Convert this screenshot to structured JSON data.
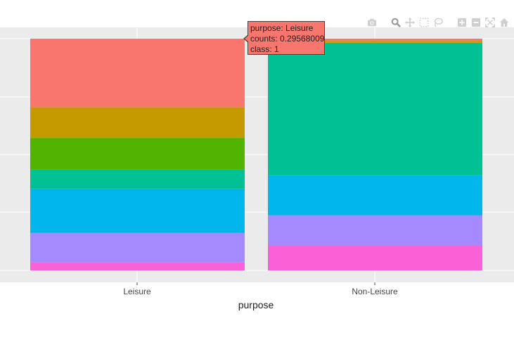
{
  "chart_data": {
    "type": "bar",
    "stacked": true,
    "normalized": true,
    "xlabel": "purpose",
    "categories": [
      "Leisure",
      "Non-Leisure"
    ],
    "ylim": [
      0,
      1
    ],
    "series": [
      {
        "color": "#F8766D",
        "values": [
          0.29568009,
          0.0095
        ]
      },
      {
        "color": "#C49A00",
        "values": [
          0.132,
          0.008
        ]
      },
      {
        "color": "#53B400",
        "values": [
          0.138,
          0.0035
        ]
      },
      {
        "color": "#00C094",
        "values": [
          0.082,
          0.569
        ]
      },
      {
        "color": "#00B6EB",
        "values": [
          0.191,
          0.172
        ]
      },
      {
        "color": "#A58AFF",
        "values": [
          0.126,
          0.129
        ]
      },
      {
        "color": "#FB61D7",
        "values": [
          0.0353,
          0.109
        ]
      }
    ],
    "grid": true,
    "background": "#EBEBEB",
    "gridline_color": "#FFFFFF"
  },
  "tooltip": {
    "line1": "purpose: Leisure",
    "line2": "counts: 0.29568009",
    "line3": "class: 1",
    "color": "#F8766D"
  },
  "modebar": {
    "icons": [
      "camera-icon",
      "zoom-icon",
      "pan-icon",
      "box-select-icon",
      "lasso-icon",
      "zoom-in-icon",
      "zoom-out-icon",
      "autoscale-icon",
      "home-icon"
    ],
    "color": "#CFCFCF"
  }
}
